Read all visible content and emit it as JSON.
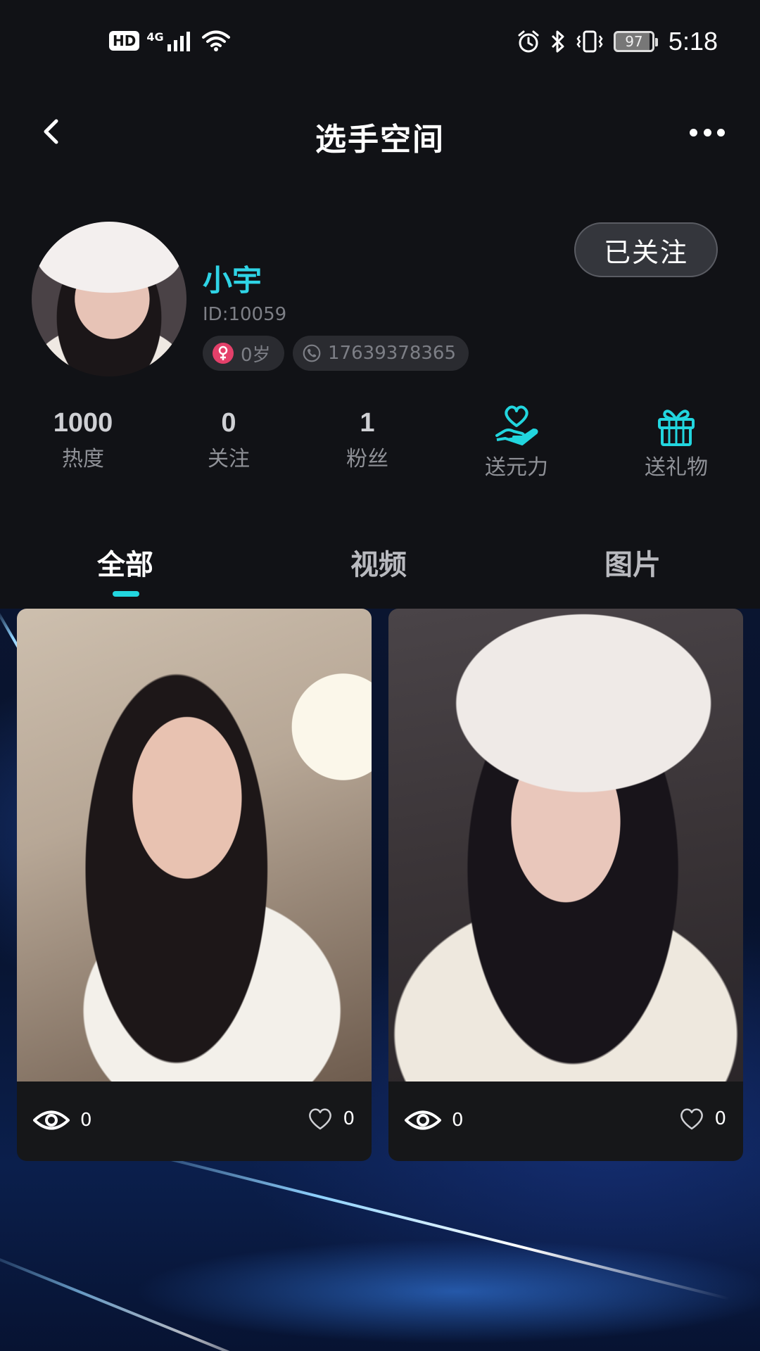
{
  "status_bar": {
    "hd_label": "HD",
    "network_label": "4G",
    "battery_level": "97",
    "time": "5:18"
  },
  "nav": {
    "title": "选手空间"
  },
  "profile": {
    "name": "小宇",
    "id_text": "ID:10059",
    "age_text": "0岁",
    "phone": "17639378365",
    "follow_label": "已关注"
  },
  "stats": [
    {
      "value": "1000",
      "label": "热度"
    },
    {
      "value": "0",
      "label": "关注"
    },
    {
      "value": "1",
      "label": "粉丝"
    }
  ],
  "actions": [
    {
      "label": "送元力",
      "icon": "heart-hand-icon"
    },
    {
      "label": "送礼物",
      "icon": "gift-icon"
    }
  ],
  "tabs": [
    {
      "label": "全部",
      "active": true
    },
    {
      "label": "视频",
      "active": false
    },
    {
      "label": "图片",
      "active": false
    }
  ],
  "posts": [
    {
      "views": "0",
      "likes": "0"
    },
    {
      "views": "0",
      "likes": "0"
    }
  ],
  "colors": {
    "accent": "#22d6df",
    "background": "#111216",
    "female": "#e4406a"
  }
}
